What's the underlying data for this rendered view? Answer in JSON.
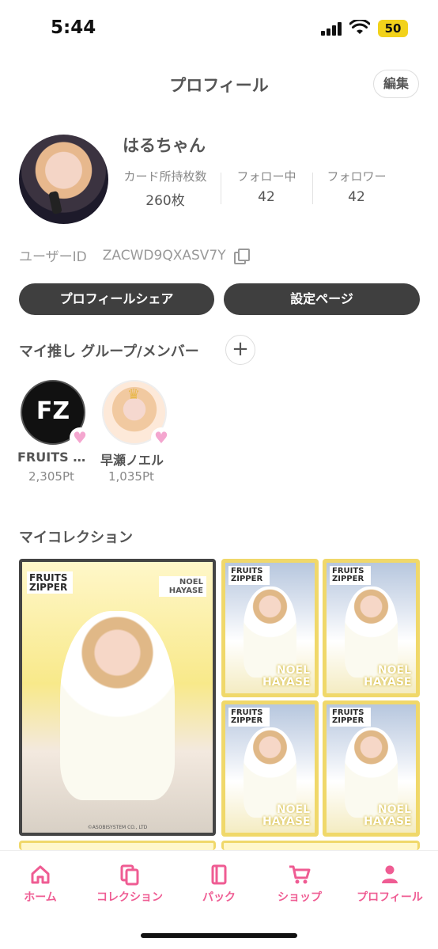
{
  "status_bar": {
    "time": "5:44",
    "battery": "50"
  },
  "header": {
    "title": "プロフィール",
    "edit_label": "編集"
  },
  "profile": {
    "username": "はるちゃん",
    "stats": [
      {
        "label": "カード所持枚数",
        "value": "260枚"
      },
      {
        "label": "フォロー中",
        "value": "42"
      },
      {
        "label": "フォロワー",
        "value": "42"
      }
    ],
    "user_id_label": "ユーザーID",
    "user_id": "ZACWD9QXASV7Y"
  },
  "actions": {
    "share_label": "プロフィールシェア",
    "settings_label": "設定ページ"
  },
  "oshi_section": {
    "title": "マイ推し グループ/メンバー",
    "items": [
      {
        "name": "FRUITS …",
        "points": "2,305Pt",
        "logo_text": "FZ"
      },
      {
        "name": "早瀬ノエル",
        "points": "1,035Pt"
      }
    ]
  },
  "collection_section": {
    "title": "マイコレクション",
    "big_card": {
      "brand": "FRUITS ZIPPER",
      "member": "NOEL HAYASE",
      "copyright": "©ASOBISYSTEM CO., LTD"
    },
    "small_cards": [
      {
        "brand": "FRUITS ZIPPER",
        "member": "NOEL HAYASE"
      },
      {
        "brand": "FRUITS ZIPPER",
        "member": "NOEL HAYASE"
      },
      {
        "brand": "FRUITS ZIPPER",
        "member": "NOEL HAYASE"
      },
      {
        "brand": "FRUITS ZIPPER",
        "member": "NOEL HAYASE"
      }
    ]
  },
  "tabbar": {
    "tabs": [
      {
        "label": "ホーム",
        "icon": "home-icon"
      },
      {
        "label": "コレクション",
        "icon": "collection-icon"
      },
      {
        "label": "パック",
        "icon": "pack-icon"
      },
      {
        "label": "ショップ",
        "icon": "cart-icon"
      },
      {
        "label": "プロフィール",
        "icon": "person-icon"
      }
    ],
    "active_color": "#ef5c93"
  }
}
